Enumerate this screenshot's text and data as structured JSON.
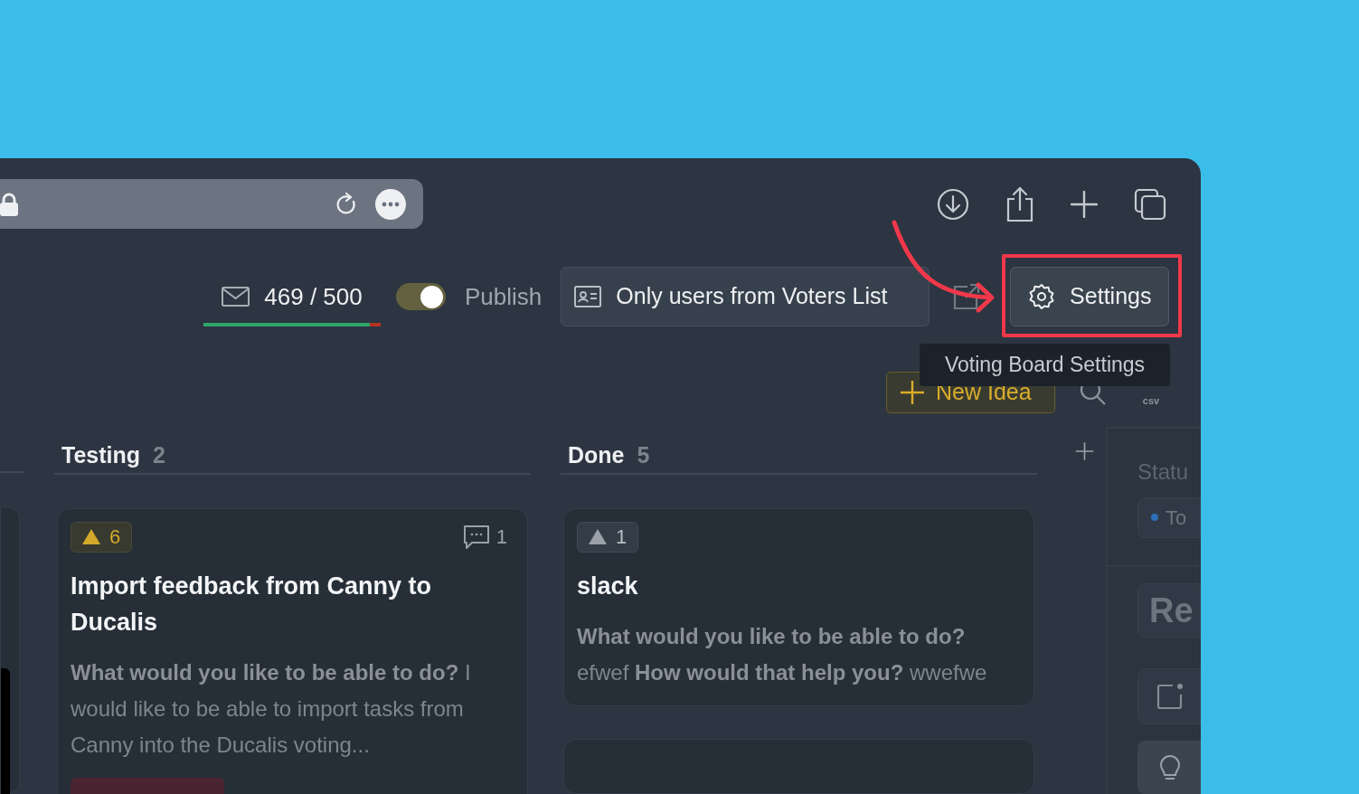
{
  "header": {
    "email_quota": {
      "text": "469 / 500",
      "level": 0.94
    },
    "publish": {
      "label": "Publish",
      "on": true
    },
    "access_button": "Only users from Voters List",
    "settings_button": "Settings",
    "tooltip": "Voting Board Settings",
    "new_idea_button": "New Idea",
    "export_label": "csv"
  },
  "columns": [
    {
      "title": "Testing",
      "count": "2",
      "cards": [
        {
          "votes": "6",
          "voted": true,
          "comments": "1",
          "title": "Import feedback from Canny to Ducalis",
          "body": "**What would you like to be able to do?** I would like to be able to import tasks from Canny into the Ducalis voting..."
        }
      ]
    },
    {
      "title": "Done",
      "count": "5",
      "cards": [
        {
          "votes": "1",
          "voted": false,
          "title": "slack",
          "body": "**What would you like to be able to do?** efwef **How would that help you?** wwefwe"
        }
      ]
    }
  ],
  "side_panel": {
    "heading": "Statu",
    "status": "To",
    "title": "Re"
  }
}
